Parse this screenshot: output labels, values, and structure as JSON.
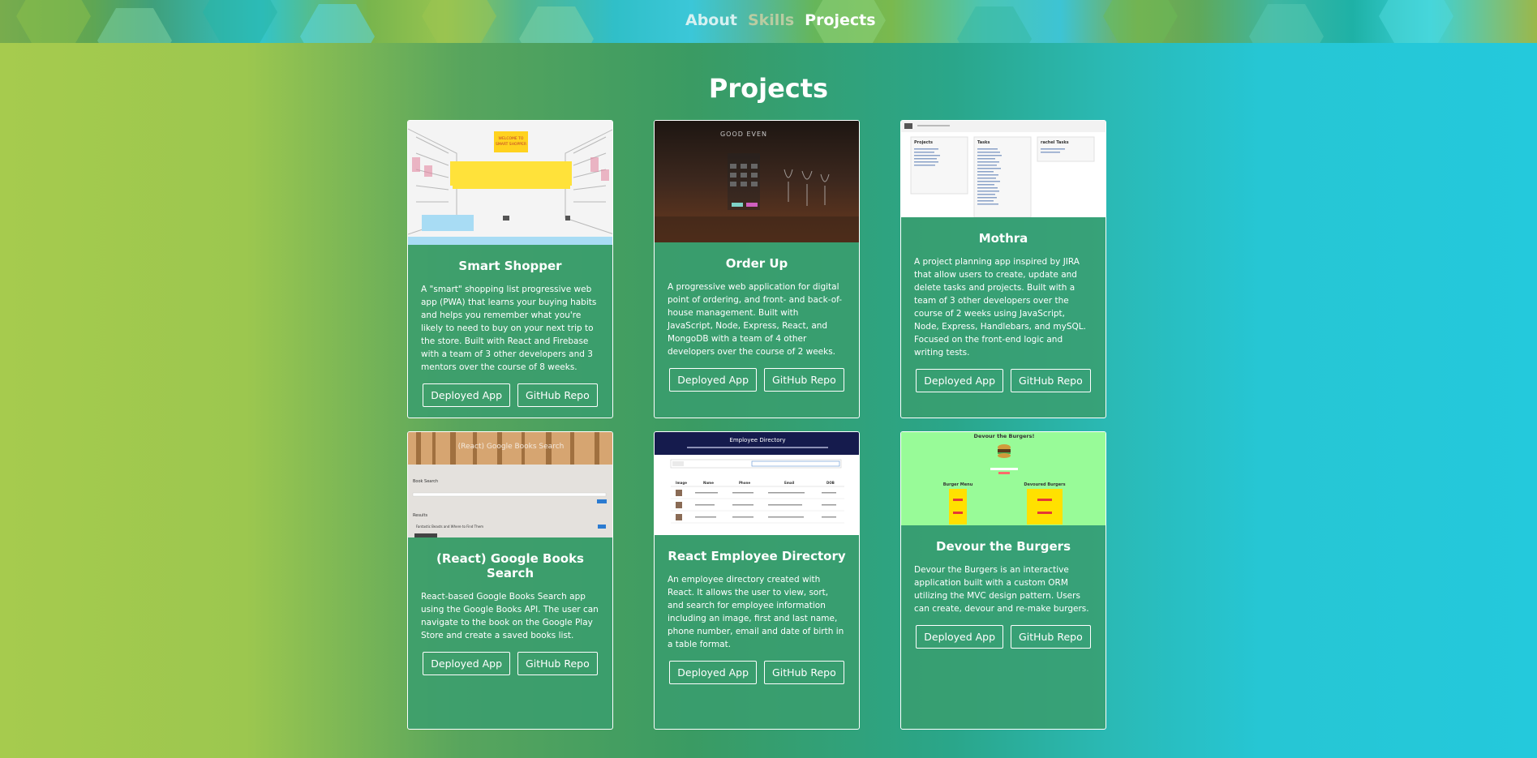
{
  "nav": {
    "about": "About",
    "skills": "Skills",
    "projects": "Projects"
  },
  "page": {
    "title": "Projects"
  },
  "colors": {
    "card_border": "#ffffff",
    "text": "#ffffff",
    "gradient_left": "#a6cb4e",
    "gradient_right": "#24c9dc"
  },
  "projects": [
    {
      "title": "Smart Shopper",
      "description": "A \"smart\" shopping list progressive web app (PWA) that learns your buying habits and helps you remember what you're likely to need to buy on your next trip to the store. Built with React and Firebase with a team of 3 other developers and 3 mentors over the course of 8 weeks.",
      "deployed_label": "Deployed App",
      "github_label": "GitHub Repo",
      "image": {
        "welcome_line1": "WELCOME TO",
        "welcome_line2": "SMART SHOPPER"
      }
    },
    {
      "title": "Order Up",
      "description": "A progressive web application for digital point of ordering, and front- and back-of-house management. Built with JavaScript, Node, Express, React, and MongoDB with a team of 4 other developers over the course of 2 weeks.",
      "deployed_label": "Deployed App",
      "github_label": "GitHub Repo",
      "image": {
        "sign": "GOOD EVEN"
      }
    },
    {
      "title": "Mothra",
      "description": "A project planning app inspired by JIRA that allow users to create, update and delete tasks and projects. Built with a team of 3 other developers over the course of 2 weeks using JavaScript, Node, Express, Handlebars, and mySQL. Focused on the front-end logic and writing tests.",
      "deployed_label": "Deployed App",
      "github_label": "GitHub Repo",
      "image": {
        "col1": "Projects",
        "col2": "Tasks",
        "col3": "rachel Tasks"
      }
    },
    {
      "title": "(React) Google Books Search",
      "description": "React-based Google Books Search app using the Google Books API. The user can navigate to the book on the Google Play  Store and create a saved books list.",
      "deployed_label": "Deployed App",
      "github_label": "GitHub Repo",
      "image": {
        "banner": "(React) Google Books Search",
        "section": "Book Search",
        "results": "Results",
        "result_item": "Fantastic Beasts and Where to Find Them"
      }
    },
    {
      "title": "React Employee Directory",
      "description": "An employee directory created with React. It allows the user to view, sort, and search for employee information including an image, first and last name, phone number, email and date of birth in a table format.",
      "deployed_label": "Deployed App",
      "github_label": "GitHub Repo",
      "image": {
        "header": "Employee Directory",
        "columns": [
          "Image",
          "Name",
          "Phone",
          "Email",
          "DOB"
        ]
      }
    },
    {
      "title": "Devour the Burgers",
      "description": "Devour the Burgers is an interactive application built with a custom ORM utilizing the MVC design pattern. Users can create, devour and re-make burgers.",
      "deployed_label": "Deployed App",
      "github_label": "GitHub Repo",
      "image": {
        "header": "Devour the Burgers!",
        "menu": "Burger Menu",
        "devoured": "Devoured Burgers"
      }
    }
  ]
}
